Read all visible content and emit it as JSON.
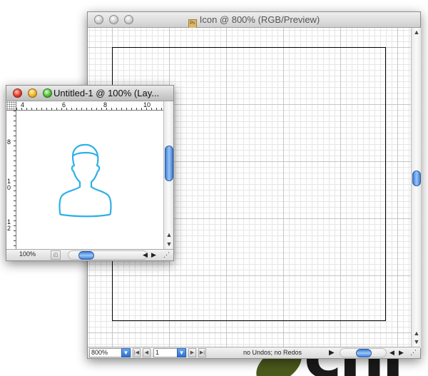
{
  "background": {
    "logo_text": "chi",
    "logo_colors": {
      "leaf": "#4b5a1c",
      "text": "#1a1a1a"
    }
  },
  "main_window": {
    "title": "Icon @ 800% (RGB/Preview)",
    "doc_icon_name": "photoshop-document-icon",
    "status": {
      "zoom": "800%",
      "page": "1",
      "undo_text": "no Undos; no Redos"
    }
  },
  "small_window": {
    "title": "Untitled-1 @ 100% (Lay...",
    "ruler_top_labels": [
      "4",
      "6",
      "8",
      "10"
    ],
    "ruler_left_labels": [
      "8",
      "1\n0",
      "1\n2"
    ],
    "zoom": "100%",
    "artwork": {
      "name": "person-silhouette-icon",
      "stroke_color": "#2fb0e8"
    }
  },
  "colors": {
    "scroll_accent": "#3d7ed8",
    "grid_major": "#c5c5c5",
    "grid_minor": "#e6e6e6"
  }
}
